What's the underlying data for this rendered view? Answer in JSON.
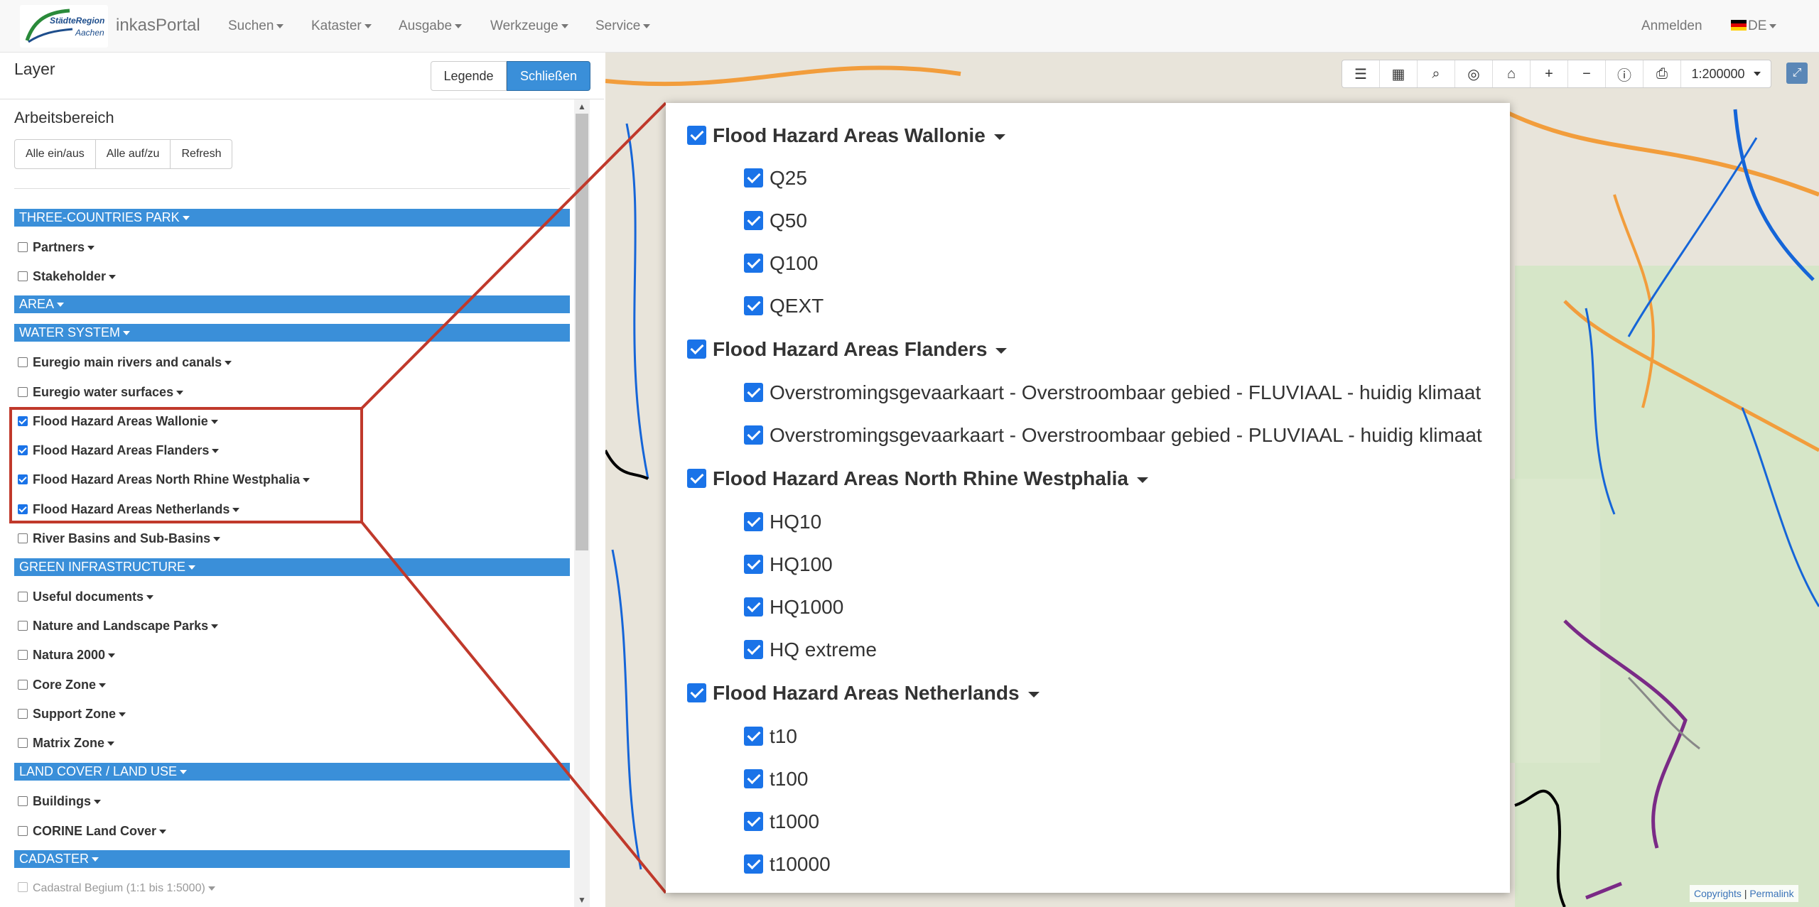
{
  "navbar": {
    "logo_line1": "StädteRegion",
    "logo_line2": "Aachen",
    "brand": "inkasPortal",
    "menu": [
      "Suchen",
      "Kataster",
      "Ausgabe",
      "Werkzeuge",
      "Service"
    ],
    "login": "Anmelden",
    "language": "DE"
  },
  "sidebar": {
    "title": "Layer",
    "legend_button": "Legende",
    "close_button": "Schließen",
    "workspace_title": "Arbeitsbereich",
    "workspace_buttons": [
      "Alle ein/aus",
      "Alle auf/zu",
      "Refresh"
    ],
    "groups": {
      "g1": "THREE-COUNTRIES PARK",
      "g2": "AREA",
      "g3": "WATER SYSTEM",
      "g4": "GREEN INFRASTRUCTURE",
      "g5": "LAND COVER / LAND USE",
      "g6": "CADASTER"
    },
    "layers": {
      "partners": "Partners",
      "stakeholder": "Stakeholder",
      "euregio_rivers": "Euregio main rivers and canals",
      "euregio_water": "Euregio water surfaces",
      "fha_wallonie": "Flood Hazard Areas Wallonie",
      "fha_flanders": "Flood Hazard Areas Flanders",
      "fha_nrw": "Flood Hazard Areas North Rhine Westphalia",
      "fha_netherlands": "Flood Hazard Areas Netherlands",
      "river_basins": "River Basins and Sub-Basins",
      "useful_docs": "Useful documents",
      "nature_parks": "Nature and Landscape Parks",
      "natura": "Natura 2000",
      "core_zone": "Core Zone",
      "support_zone": "Support Zone",
      "matrix_zone": "Matrix Zone",
      "buildings": "Buildings",
      "corine": "CORINE Land Cover",
      "cadastral_belgium": "Cadastral Begium (1:1 bis 1:5000)"
    }
  },
  "map": {
    "scale": "1:200000",
    "attribution_copyrights": "Copyrights",
    "attribution_sep": "|",
    "attribution_permalink": "Permalink"
  },
  "callout": {
    "wallonie": {
      "title": "Flood Hazard Areas Wallonie",
      "items": [
        "Q25",
        "Q50",
        "Q100",
        "QEXT"
      ]
    },
    "flanders": {
      "title": "Flood Hazard Areas Flanders",
      "items": [
        "Overstromingsgevaarkaart - Overstroombaar gebied - FLUVIAAL - huidig klimaat",
        "Overstromingsgevaarkaart - Overstroombaar gebied - PLUVIAAL - huidig klimaat"
      ]
    },
    "nrw": {
      "title": "Flood Hazard Areas North Rhine Westphalia",
      "items": [
        "HQ10",
        "HQ100",
        "HQ1000",
        "HQ extreme"
      ]
    },
    "netherlands": {
      "title": "Flood Hazard Areas Netherlands",
      "items": [
        "t10",
        "t100",
        "t1000",
        "t10000"
      ]
    }
  },
  "colors": {
    "accent": "#3a8fd9",
    "checkbox": "#1a73e8",
    "highlight_frame": "#c0392b"
  }
}
